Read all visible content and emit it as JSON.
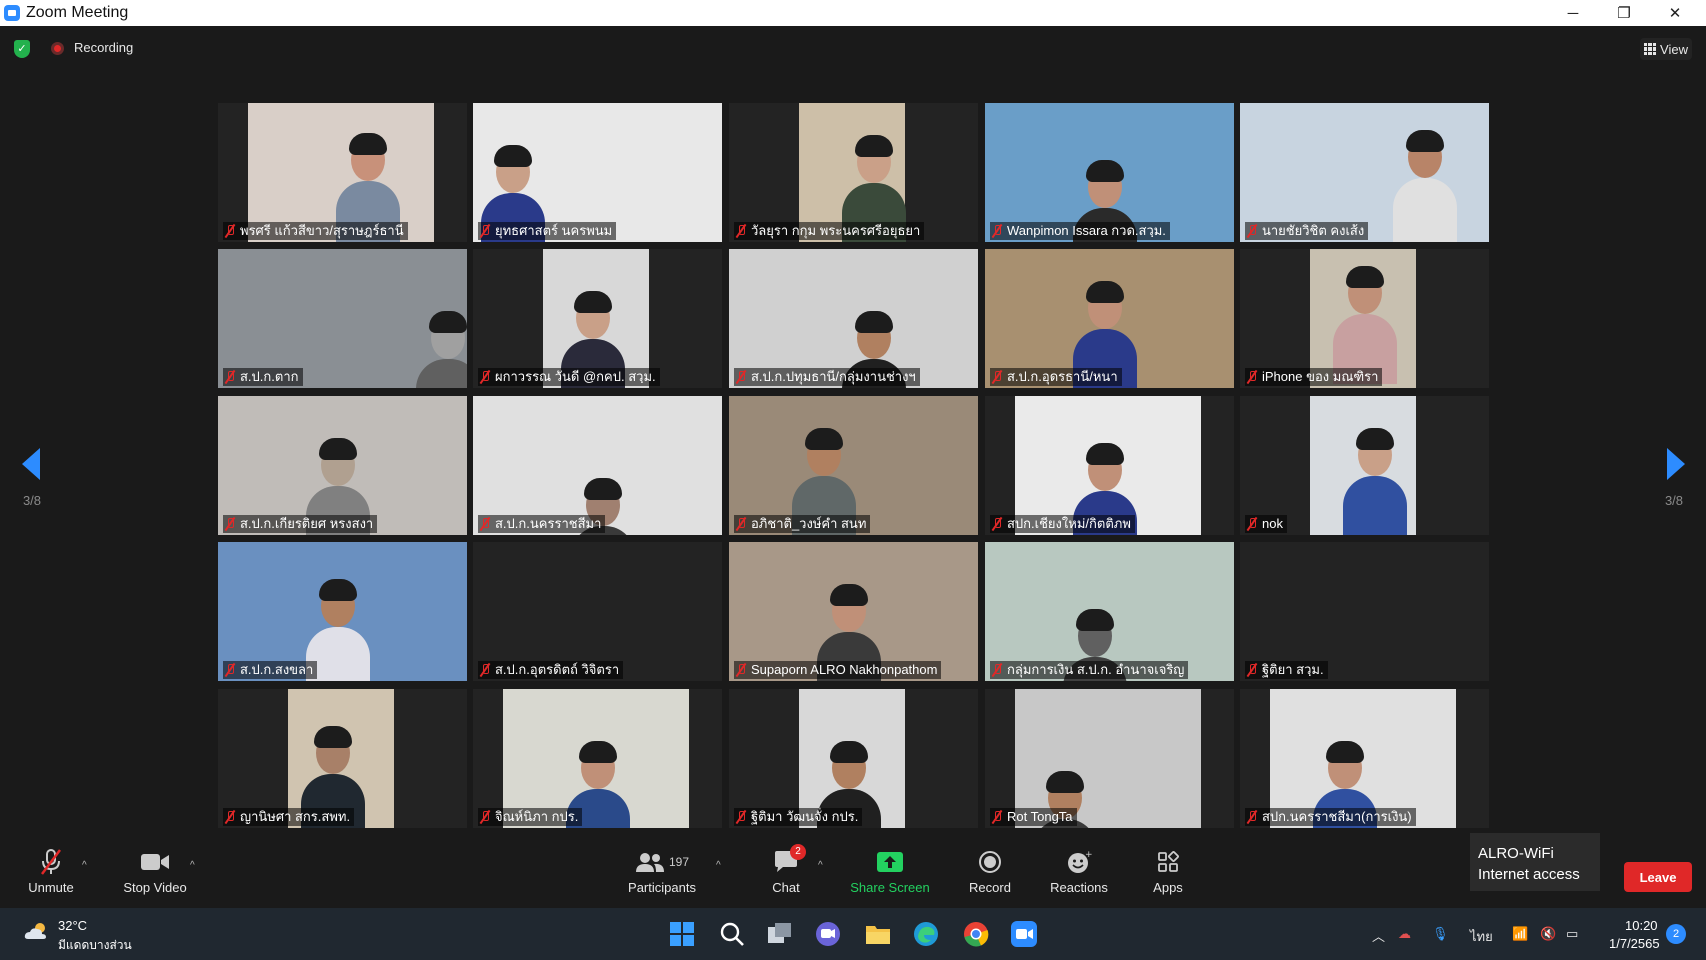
{
  "window": {
    "title": "Zoom Meeting",
    "minimize": "─",
    "restore": "❐",
    "close": "✕"
  },
  "topbar": {
    "security": "✓",
    "recording_label": "Recording",
    "view_label": "View"
  },
  "pager": {
    "left": "3/8",
    "right": "3/8"
  },
  "participants": [
    {
      "name": "พรศรี แก้วสีขาว/สุราษฎร์ธานี"
    },
    {
      "name": "ยุทธศาสตร์ นครพนม"
    },
    {
      "name": "วัลยุรา กกุม พระนครศรีอยุธยา"
    },
    {
      "name": "Wanpimon Issara กวด.สวฺม."
    },
    {
      "name": "นายชัยวิชิต คงเส้ง"
    },
    {
      "name": "ส.ป.ก.ตาก"
    },
    {
      "name": "ผกาวรรณ วันดี @กคป. สวฺม."
    },
    {
      "name": "ส.ป.ก.ปทุมธานี/กลุ่มงานช่างฯ"
    },
    {
      "name": "ส.ป.ก.อุดรธานี/หนา"
    },
    {
      "name": "iPhone ของ มณฑิรา"
    },
    {
      "name": "ส.ป.ก.เกียรติยศ หรงสงา"
    },
    {
      "name": "ส.ป.ก.นครราชสีมา"
    },
    {
      "name": "อภิชาติ_วงษ์คำ สนท"
    },
    {
      "name": "สปก.เชียงใหม่/กิตติภพ"
    },
    {
      "name": "nok"
    },
    {
      "name": "ส.ป.ก.สงขลา"
    },
    {
      "name": "ส.ป.ก.อุตรดิตถ์ วิจิตรา"
    },
    {
      "name": "Supaporn ALRO Nakhonpathom"
    },
    {
      "name": "กลุ่มการเงิน ส.ป.ก. อำนาจเจริญ"
    },
    {
      "name": "ฐิติยา สวฺม."
    },
    {
      "name": "ญานิษศา สกร.สพท."
    },
    {
      "name": "จิณห์นิภา กปร."
    },
    {
      "name": "ฐิติมา วัฒนจั่ง กปร."
    },
    {
      "name": "Rot TongTa"
    },
    {
      "name": "สปก.นครราชสีมา(การเงิน)"
    }
  ],
  "toolbar": {
    "unmute": "Unmute",
    "stop_video": "Stop Video",
    "participants_label": "Participants",
    "participants_count": "197",
    "chat_label": "Chat",
    "chat_badge": "2",
    "share_label": "Share Screen",
    "record_label": "Record",
    "reactions_label": "Reactions",
    "apps_label": "Apps",
    "leave_label": "Leave"
  },
  "wifi_tooltip": {
    "network": "ALRO-WiFi",
    "status": "Internet access"
  },
  "taskbar": {
    "weather_temp": "32°C",
    "weather_desc": "มีแดดบางส่วน",
    "language": "ไทย",
    "time": "10:20",
    "date": "1/7/2565",
    "notifications": "2"
  },
  "colors": {
    "accent": "#2d8cff",
    "leave": "#e02828",
    "active_speaker": "#c8e26a",
    "share": "#23d160"
  }
}
